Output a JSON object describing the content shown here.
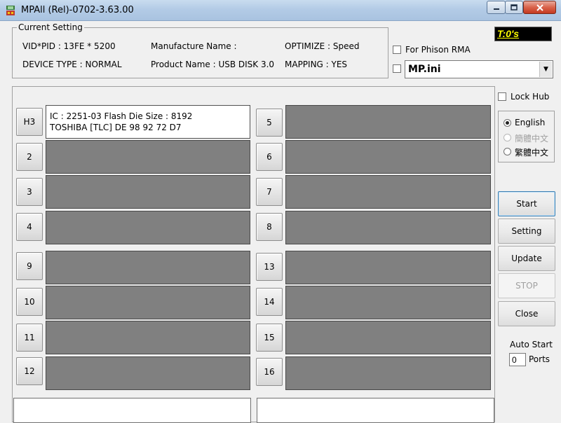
{
  "window": {
    "title": "MPAll (Rel)-0702-3.63.00"
  },
  "current_setting": {
    "legend": "Current Setting",
    "vid_pid": "VID*PID : 13FE * 5200",
    "manufacture_name": "Manufacture Name :",
    "optimize": "OPTIMIZE : Speed",
    "device_type": "DEVICE TYPE : NORMAL",
    "product_name": "Product Name : USB DISK 3.0",
    "mapping": "MAPPING : YES"
  },
  "timer": "T:0's",
  "phison_rma": {
    "label": "For Phison RMA",
    "checked": false
  },
  "ini_file": {
    "checked": false,
    "value": "MP.ini"
  },
  "ports": {
    "left": [
      {
        "label": "H3",
        "active": true,
        "line1": "IC : 2251-03  Flash Die Size : 8192",
        "line2": "TOSHIBA [TLC] DE 98 92 72 D7"
      },
      {
        "label": "2"
      },
      {
        "label": "3"
      },
      {
        "label": "4"
      },
      {
        "label": "9"
      },
      {
        "label": "10"
      },
      {
        "label": "11"
      },
      {
        "label": "12"
      }
    ],
    "right": [
      {
        "label": "5"
      },
      {
        "label": "6"
      },
      {
        "label": "7"
      },
      {
        "label": "8"
      },
      {
        "label": "13"
      },
      {
        "label": "14"
      },
      {
        "label": "15"
      },
      {
        "label": "16"
      }
    ]
  },
  "lock_hub": {
    "label": "Lock Hub",
    "checked": false
  },
  "languages": [
    {
      "label": "English",
      "selected": true,
      "enabled": true
    },
    {
      "label": "簡體中文",
      "selected": false,
      "enabled": false
    },
    {
      "label": "繁體中文",
      "selected": false,
      "enabled": true
    }
  ],
  "buttons": {
    "start": "Start",
    "setting": "Setting",
    "update": "Update",
    "stop": "STOP",
    "close": "Close"
  },
  "auto_start": {
    "label": "Auto Start",
    "value": "0",
    "unit": "Ports"
  }
}
